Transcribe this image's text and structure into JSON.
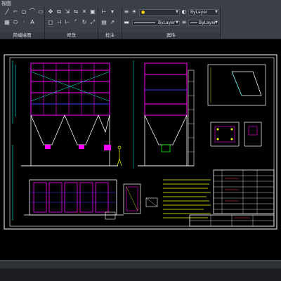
{
  "window": {
    "title": "视图"
  },
  "ribbon": {
    "panels": [
      {
        "label": "简编绘图"
      },
      {
        "label": "修改"
      },
      {
        "label": "标注"
      },
      {
        "label": "属性"
      }
    ],
    "properties": {
      "color_value": "ByLayer",
      "linetype_value": "ByLayer",
      "lineweight_value": "ByLayer"
    }
  },
  "colors": {
    "ribbon_bg": "#3b4048",
    "canvas_bg": "#000000",
    "frame": "#ffffff",
    "magenta": "#ff00ff",
    "cyan": "#00ffff",
    "yellow": "#ffff00",
    "green": "#00ff00",
    "blue": "#3a3aff",
    "red": "#ff3030"
  }
}
